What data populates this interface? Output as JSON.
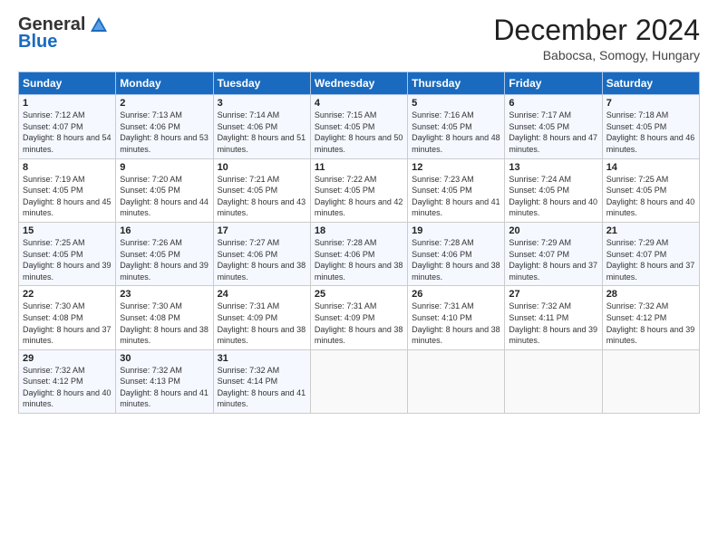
{
  "logo": {
    "general": "General",
    "blue": "Blue"
  },
  "header": {
    "month": "December 2024",
    "location": "Babocsa, Somogy, Hungary"
  },
  "days_of_week": [
    "Sunday",
    "Monday",
    "Tuesday",
    "Wednesday",
    "Thursday",
    "Friday",
    "Saturday"
  ],
  "weeks": [
    [
      {
        "day": "1",
        "sunrise": "7:12 AM",
        "sunset": "4:07 PM",
        "daylight": "8 hours and 54 minutes."
      },
      {
        "day": "2",
        "sunrise": "7:13 AM",
        "sunset": "4:06 PM",
        "daylight": "8 hours and 53 minutes."
      },
      {
        "day": "3",
        "sunrise": "7:14 AM",
        "sunset": "4:06 PM",
        "daylight": "8 hours and 51 minutes."
      },
      {
        "day": "4",
        "sunrise": "7:15 AM",
        "sunset": "4:05 PM",
        "daylight": "8 hours and 50 minutes."
      },
      {
        "day": "5",
        "sunrise": "7:16 AM",
        "sunset": "4:05 PM",
        "daylight": "8 hours and 48 minutes."
      },
      {
        "day": "6",
        "sunrise": "7:17 AM",
        "sunset": "4:05 PM",
        "daylight": "8 hours and 47 minutes."
      },
      {
        "day": "7",
        "sunrise": "7:18 AM",
        "sunset": "4:05 PM",
        "daylight": "8 hours and 46 minutes."
      }
    ],
    [
      {
        "day": "8",
        "sunrise": "7:19 AM",
        "sunset": "4:05 PM",
        "daylight": "8 hours and 45 minutes."
      },
      {
        "day": "9",
        "sunrise": "7:20 AM",
        "sunset": "4:05 PM",
        "daylight": "8 hours and 44 minutes."
      },
      {
        "day": "10",
        "sunrise": "7:21 AM",
        "sunset": "4:05 PM",
        "daylight": "8 hours and 43 minutes."
      },
      {
        "day": "11",
        "sunrise": "7:22 AM",
        "sunset": "4:05 PM",
        "daylight": "8 hours and 42 minutes."
      },
      {
        "day": "12",
        "sunrise": "7:23 AM",
        "sunset": "4:05 PM",
        "daylight": "8 hours and 41 minutes."
      },
      {
        "day": "13",
        "sunrise": "7:24 AM",
        "sunset": "4:05 PM",
        "daylight": "8 hours and 40 minutes."
      },
      {
        "day": "14",
        "sunrise": "7:25 AM",
        "sunset": "4:05 PM",
        "daylight": "8 hours and 40 minutes."
      }
    ],
    [
      {
        "day": "15",
        "sunrise": "7:25 AM",
        "sunset": "4:05 PM",
        "daylight": "8 hours and 39 minutes."
      },
      {
        "day": "16",
        "sunrise": "7:26 AM",
        "sunset": "4:05 PM",
        "daylight": "8 hours and 39 minutes."
      },
      {
        "day": "17",
        "sunrise": "7:27 AM",
        "sunset": "4:06 PM",
        "daylight": "8 hours and 38 minutes."
      },
      {
        "day": "18",
        "sunrise": "7:28 AM",
        "sunset": "4:06 PM",
        "daylight": "8 hours and 38 minutes."
      },
      {
        "day": "19",
        "sunrise": "7:28 AM",
        "sunset": "4:06 PM",
        "daylight": "8 hours and 38 minutes."
      },
      {
        "day": "20",
        "sunrise": "7:29 AM",
        "sunset": "4:07 PM",
        "daylight": "8 hours and 37 minutes."
      },
      {
        "day": "21",
        "sunrise": "7:29 AM",
        "sunset": "4:07 PM",
        "daylight": "8 hours and 37 minutes."
      }
    ],
    [
      {
        "day": "22",
        "sunrise": "7:30 AM",
        "sunset": "4:08 PM",
        "daylight": "8 hours and 37 minutes."
      },
      {
        "day": "23",
        "sunrise": "7:30 AM",
        "sunset": "4:08 PM",
        "daylight": "8 hours and 38 minutes."
      },
      {
        "day": "24",
        "sunrise": "7:31 AM",
        "sunset": "4:09 PM",
        "daylight": "8 hours and 38 minutes."
      },
      {
        "day": "25",
        "sunrise": "7:31 AM",
        "sunset": "4:09 PM",
        "daylight": "8 hours and 38 minutes."
      },
      {
        "day": "26",
        "sunrise": "7:31 AM",
        "sunset": "4:10 PM",
        "daylight": "8 hours and 38 minutes."
      },
      {
        "day": "27",
        "sunrise": "7:32 AM",
        "sunset": "4:11 PM",
        "daylight": "8 hours and 39 minutes."
      },
      {
        "day": "28",
        "sunrise": "7:32 AM",
        "sunset": "4:12 PM",
        "daylight": "8 hours and 39 minutes."
      }
    ],
    [
      {
        "day": "29",
        "sunrise": "7:32 AM",
        "sunset": "4:12 PM",
        "daylight": "8 hours and 40 minutes."
      },
      {
        "day": "30",
        "sunrise": "7:32 AM",
        "sunset": "4:13 PM",
        "daylight": "8 hours and 41 minutes."
      },
      {
        "day": "31",
        "sunrise": "7:32 AM",
        "sunset": "4:14 PM",
        "daylight": "8 hours and 41 minutes."
      },
      null,
      null,
      null,
      null
    ]
  ],
  "labels": {
    "sunrise": "Sunrise:",
    "sunset": "Sunset:",
    "daylight": "Daylight:"
  }
}
